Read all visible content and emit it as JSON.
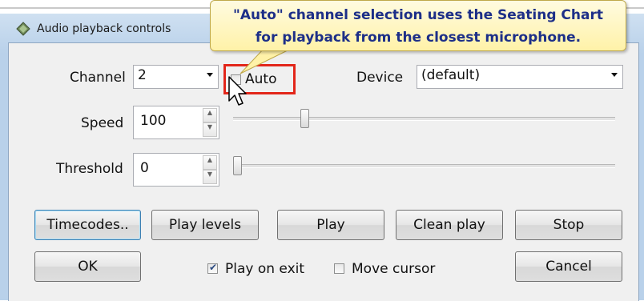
{
  "window": {
    "title": "Audio playback controls"
  },
  "tooltip": {
    "line1": "\"Auto\" channel selection uses the Seating Chart",
    "line2": "for playback from the closest microphone."
  },
  "channel": {
    "label": "Channel",
    "value": "2",
    "auto_label": "Auto",
    "auto_checked": false
  },
  "device": {
    "label": "Device",
    "value": "(default)"
  },
  "speed": {
    "label": "Speed",
    "value": "100",
    "slider_fraction": 0.18
  },
  "threshold": {
    "label": "Threshold",
    "value": "0",
    "slider_fraction": 0.0
  },
  "buttons": {
    "timecodes": "Timecodes..",
    "play_levels": "Play levels",
    "play": "Play",
    "clean_play": "Clean play",
    "stop": "Stop",
    "ok": "OK",
    "cancel": "Cancel"
  },
  "options": {
    "play_on_exit": "Play on exit",
    "play_on_exit_checked": true,
    "move_cursor": "Move cursor",
    "move_cursor_checked": false
  },
  "colors": {
    "highlight": "#e2261a",
    "tooltip_text": "#1d2f88",
    "tooltip_bg": "#fff2a8"
  },
  "icons": {
    "window": "speaker-diamond-icon",
    "cursor": "mouse-pointer-icon"
  }
}
